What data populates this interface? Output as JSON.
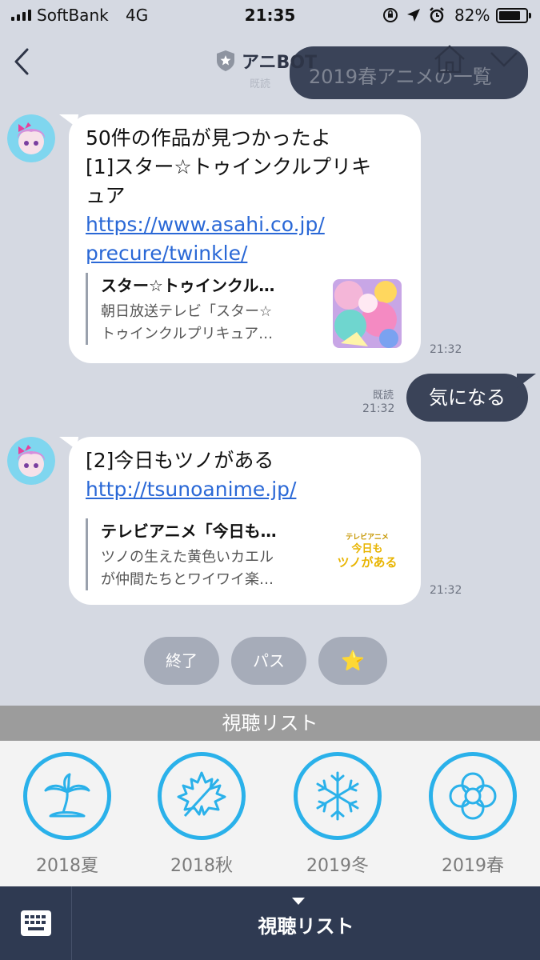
{
  "status": {
    "carrier": "SoftBank",
    "network": "4G",
    "time": "21:35",
    "battery": "82%",
    "battery_level": 0.82
  },
  "header": {
    "title": "アニBOT"
  },
  "previous_sent": {
    "text": "2019春アニメの一覧",
    "read": "既読"
  },
  "messages": [
    {
      "text_lines": [
        "50件の作品が見つかったよ",
        "[1]スター☆トゥインクルプリキ",
        "ュア"
      ],
      "link_lines": [
        "https://www.asahi.co.jp/",
        "precure/twinkle/"
      ],
      "card_title": "スター☆トゥインクル…",
      "card_desc_lines": [
        "朝日放送テレビ「スター☆",
        "トゥインクルプリキュア…"
      ],
      "time": "21:32"
    },
    {
      "text_lines": [
        "[2]今日もツノがある"
      ],
      "link_lines": [
        "http://tsunoanime.jp/"
      ],
      "card_title": "テレビアニメ「今日も…",
      "card_desc_lines": [
        "ツノの生えた黄色いカエル",
        "が仲間たちとワイワイ楽…"
      ],
      "thumb_lines": [
        "テレビアニメ",
        "今日も",
        "ツノがある"
      ],
      "time": "21:32"
    }
  ],
  "sent": {
    "text": "気になる",
    "read": "既読",
    "time": "21:32"
  },
  "quick_replies": [
    "終了",
    "パス",
    "⭐"
  ],
  "rich_menu": {
    "title": "視聴リスト",
    "items": [
      {
        "label": "2018夏",
        "icon": "palm-tree-icon"
      },
      {
        "label": "2018秋",
        "icon": "maple-leaf-icon"
      },
      {
        "label": "2019冬",
        "icon": "snowflake-icon"
      },
      {
        "label": "2019春",
        "icon": "flower-icon"
      }
    ]
  },
  "bottom_bar": {
    "label": "視聴リスト"
  },
  "colors": {
    "accent": "#2ab1ea",
    "bar": "#2f3a52",
    "link": "#2a68d6"
  }
}
